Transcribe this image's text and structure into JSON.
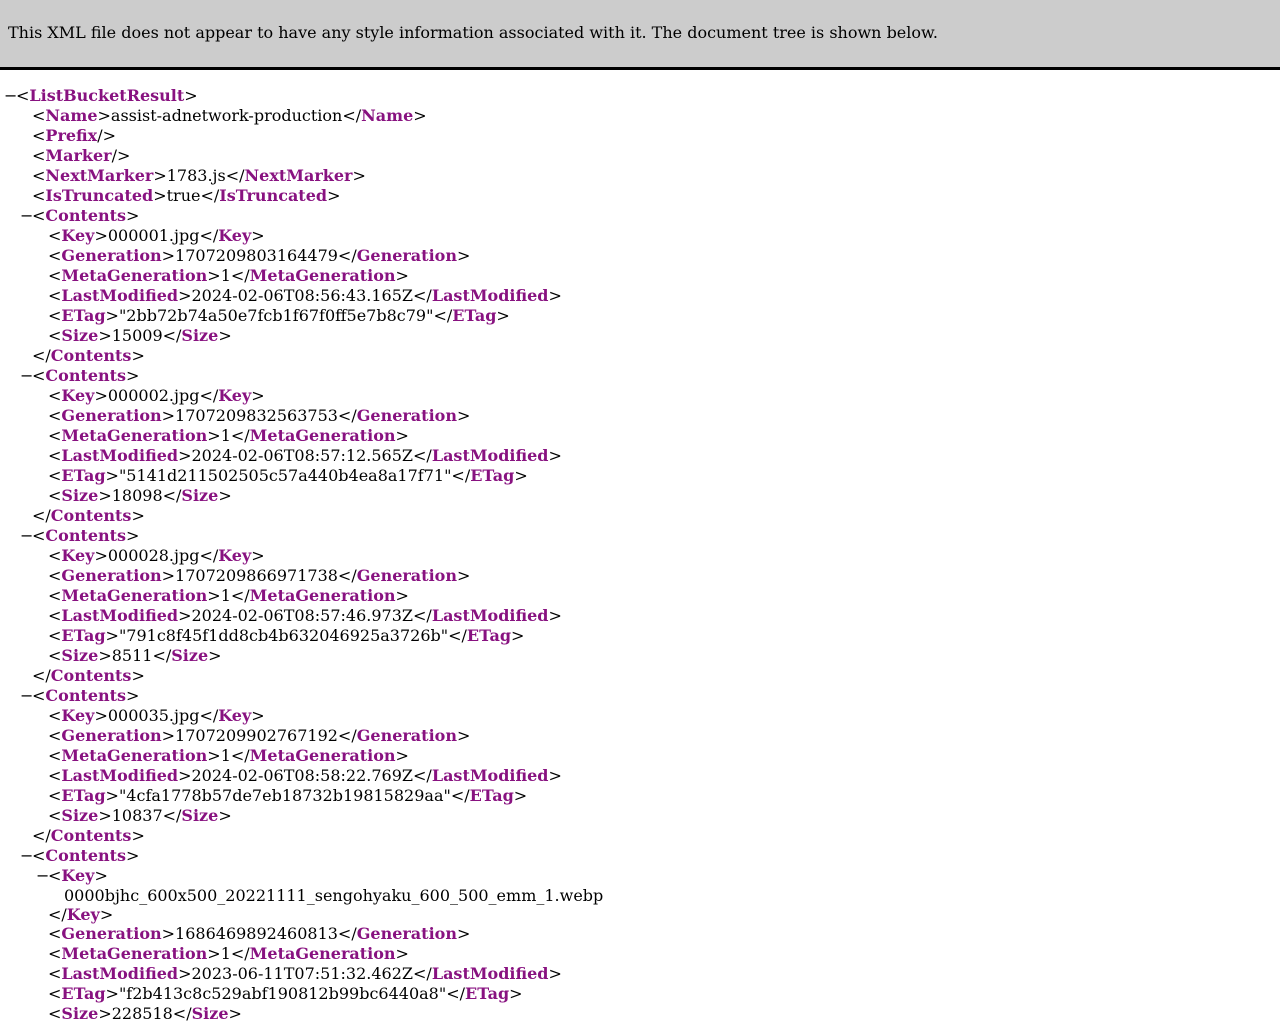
{
  "header": {
    "message": "This XML file does not appear to have any style information associated with it. The document tree is shown below."
  },
  "collapse_glyph": "−",
  "root_tag": "ListBucketResult",
  "name": "assist-adnetwork-production",
  "prefix_tag": "Prefix",
  "marker_tag": "Marker",
  "next_marker": "1783.js",
  "is_truncated": "true",
  "tags": {
    "name": "Name",
    "next_marker": "NextMarker",
    "is_truncated": "IsTruncated",
    "contents": "Contents",
    "key": "Key",
    "generation": "Generation",
    "meta_generation": "MetaGeneration",
    "last_modified": "LastModified",
    "etag": "ETag",
    "size": "Size"
  },
  "contents": [
    {
      "key": "000001.jpg",
      "generation": "1707209803164479",
      "meta_generation": "1",
      "last_modified": "2024-02-06T08:56:43.165Z",
      "etag": "\"2bb72b74a50e7fcb1f67f0ff5e7b8c79\"",
      "size": "15009"
    },
    {
      "key": "000002.jpg",
      "generation": "1707209832563753",
      "meta_generation": "1",
      "last_modified": "2024-02-06T08:57:12.565Z",
      "etag": "\"5141d211502505c57a440b4ea8a17f71\"",
      "size": "18098"
    },
    {
      "key": "000028.jpg",
      "generation": "1707209866971738",
      "meta_generation": "1",
      "last_modified": "2024-02-06T08:57:46.973Z",
      "etag": "\"791c8f45f1dd8cb4b632046925a3726b\"",
      "size": "8511"
    },
    {
      "key": "000035.jpg",
      "generation": "1707209902767192",
      "meta_generation": "1",
      "last_modified": "2024-02-06T08:58:22.769Z",
      "etag": "\"4cfa1778b57de7eb18732b19815829aa\"",
      "size": "10837"
    },
    {
      "key": "0000bjhc_600x500_20221111_sengohyaku_600_500_emm_1.webp",
      "generation": "1686469892460813",
      "meta_generation": "1",
      "last_modified": "2023-06-11T07:51:32.462Z",
      "etag": "\"f2b413c8c529abf190812b99bc6440a8\"",
      "size": "228518"
    }
  ]
}
